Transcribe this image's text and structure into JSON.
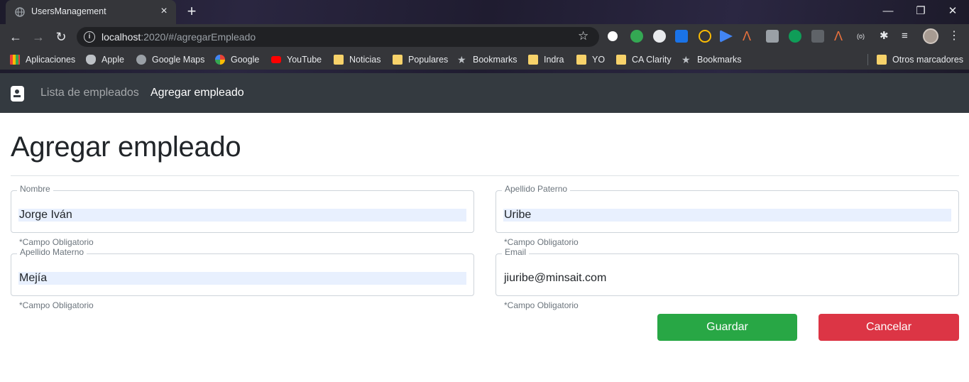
{
  "browser": {
    "tab_title": "UsersManagement",
    "new_tab": "+",
    "url_host": "localhost",
    "url_rest": ":2020/#/agregarEmpleado",
    "window_controls": {
      "minimize": "—",
      "restore": "❐",
      "close": "✕"
    },
    "bookmarks": [
      {
        "label": "Aplicaciones",
        "icon": "apps-grid-icon"
      },
      {
        "label": "Apple",
        "icon": "apple-icon"
      },
      {
        "label": "Google Maps",
        "icon": "globe-icon"
      },
      {
        "label": "Google",
        "icon": "google-icon"
      },
      {
        "label": "YouTube",
        "icon": "youtube-icon"
      },
      {
        "label": "Noticias",
        "icon": "folder-icon"
      },
      {
        "label": "Populares",
        "icon": "folder-icon"
      },
      {
        "label": "Bookmarks",
        "icon": "star-icon"
      },
      {
        "label": "Indra",
        "icon": "folder-icon"
      },
      {
        "label": "YO",
        "icon": "folder-icon"
      },
      {
        "label": "CA Clarity",
        "icon": "folder-icon"
      },
      {
        "label": "Bookmarks",
        "icon": "star-icon"
      },
      {
        "label": "Otros marcadores",
        "icon": "folder-icon"
      }
    ]
  },
  "navbar": {
    "links": [
      "Lista de empleados",
      "Agregar empleado"
    ],
    "active_index": 1,
    "background": "#343a40"
  },
  "page": {
    "title": "Agregar empleado"
  },
  "form": {
    "nombre": {
      "label": "Nombre",
      "value": "Jorge Iván",
      "hint": "*Campo Obligatorio"
    },
    "apellido_paterno": {
      "label": "Apellido Paterno",
      "value": "Uribe",
      "hint": "*Campo Obligatorio"
    },
    "apellido_materno": {
      "label": "Apellido Materno",
      "value": "Mejía",
      "hint": "*Campo Obligatorio"
    },
    "email": {
      "label": "Email",
      "value": "jiuribe@minsait.com",
      "hint": "*Campo Obligatorio"
    },
    "save_label": "Guardar",
    "cancel_label": "Cancelar"
  },
  "colors": {
    "success": "#28a745",
    "danger": "#dc3545",
    "autofill": "#e8f0fe"
  }
}
